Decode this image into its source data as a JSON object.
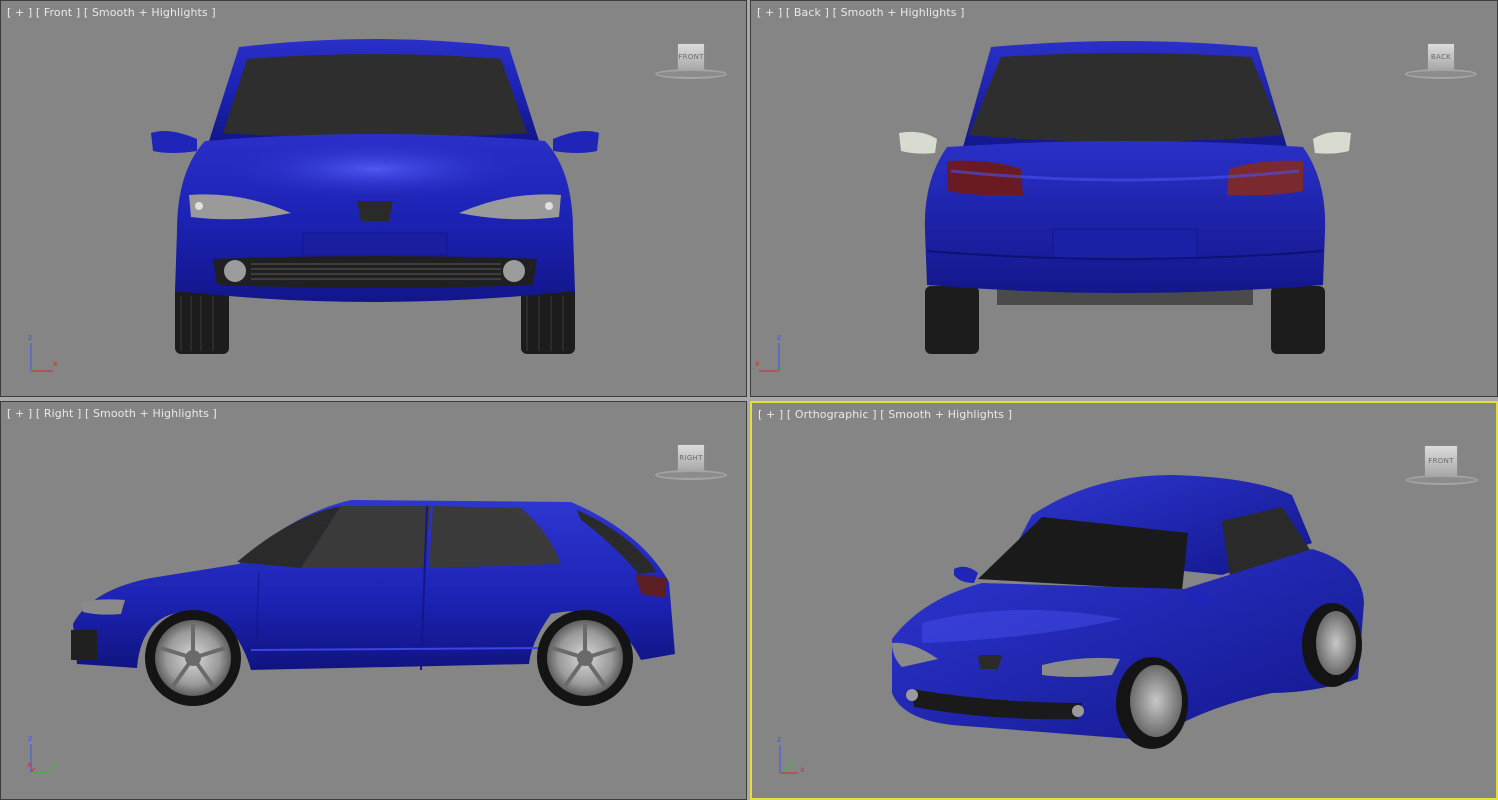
{
  "viewports": [
    {
      "id": "front",
      "label_plus": "[ + ]",
      "label_view": "[ Front ]",
      "label_shading": "[ Smooth + Highlights ]",
      "cube_label": "FRONT",
      "axes": {
        "up": "z",
        "right": "x"
      },
      "active": false
    },
    {
      "id": "back",
      "label_plus": "[ + ]",
      "label_view": "[ Back ]",
      "label_shading": "[ Smooth + Highlights ]",
      "cube_label": "BACK",
      "axes": {
        "up": "z",
        "left": "x"
      },
      "active": false
    },
    {
      "id": "right",
      "label_plus": "[ + ]",
      "label_view": "[ Right ]",
      "label_shading": "[ Smooth + Highlights ]",
      "cube_label": "RIGHT",
      "axes": {
        "up": "z",
        "left": "x",
        "right": "y"
      },
      "active": false
    },
    {
      "id": "orthographic",
      "label_plus": "[ + ]",
      "label_view": "[ Orthographic ]",
      "label_shading": "[ Smooth + Highlights ]",
      "cube_label": "FRONT",
      "axes": {
        "up": "z",
        "left": "y",
        "right": "x"
      },
      "active": true
    }
  ],
  "colors": {
    "viewport_bg": "#858585",
    "active_border": "#e8de3a",
    "car_body": "#1a1fa8",
    "glass": "#2b2b2b",
    "axis_x": "#d22c2c",
    "axis_y": "#2fbf2f",
    "axis_z": "#3a56ff"
  }
}
